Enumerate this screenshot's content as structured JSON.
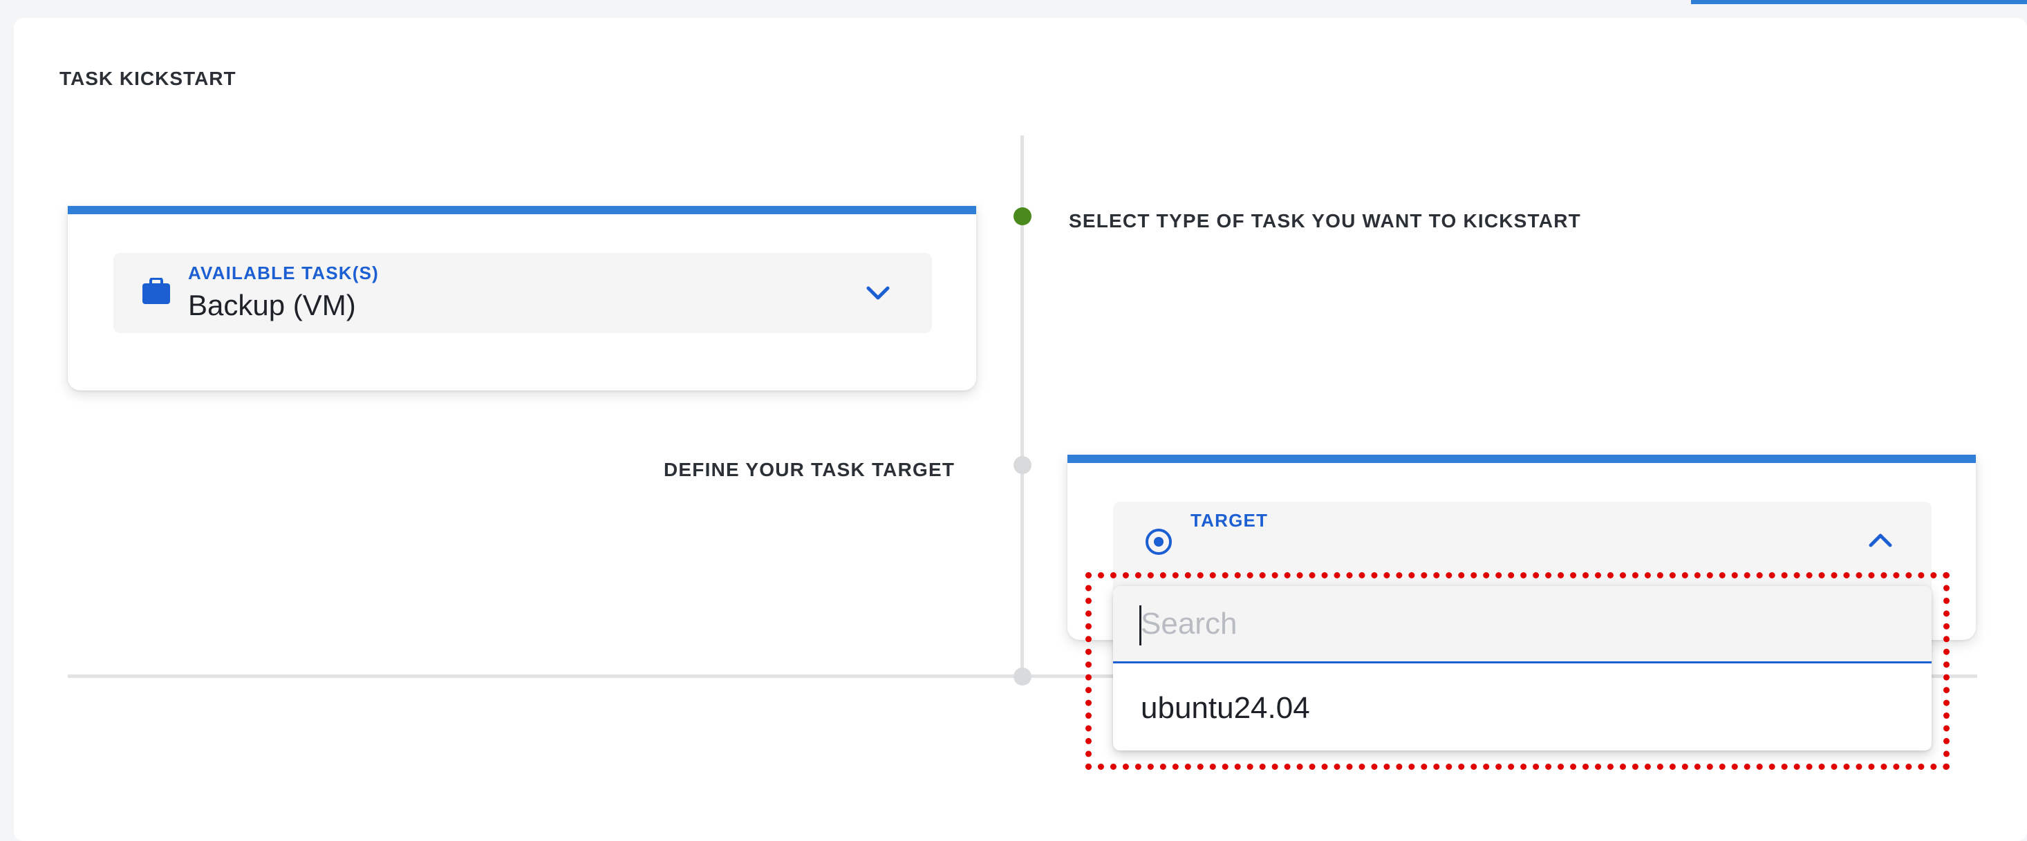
{
  "page": {
    "title": "TASK KICKSTART"
  },
  "steps": {
    "task_type": {
      "label": "SELECT TYPE OF TASK YOU WANT TO KICKSTART"
    },
    "task_target": {
      "label": "DEFINE YOUR TASK TARGET"
    }
  },
  "task_select": {
    "label": "AVAILABLE TASK(S)",
    "value": "Backup (VM)",
    "icon": "briefcase-icon",
    "state": "collapsed"
  },
  "target_select": {
    "label": "TARGET",
    "value": "",
    "icon": "target-icon",
    "state": "expanded"
  },
  "dropdown": {
    "search_placeholder": "Search",
    "search_value": "",
    "options": [
      "ubuntu24.04"
    ]
  },
  "colors": {
    "accent": "#2f7fd9",
    "label_blue": "#1b5fd3",
    "step_active": "#4a8a1c",
    "step_inactive": "#d9dadc",
    "highlight": "#e00000"
  }
}
